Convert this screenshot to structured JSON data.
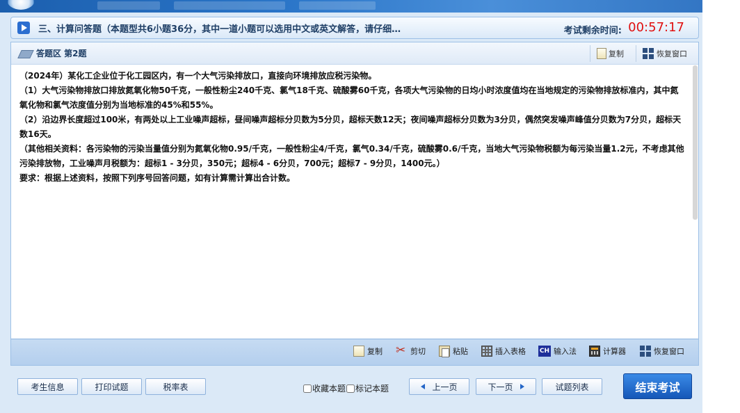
{
  "section": {
    "title": "三、计算问答题（本题型共6小题36分，其中一道小题可以选用中文或英文解答，请仔细…",
    "timer_label": "考试剩余时间:",
    "timer_value": "00:57:17"
  },
  "answer_area": {
    "title": "答题区 第2题",
    "copy_label": "复制",
    "restore_label": "恢复窗口"
  },
  "question": {
    "paragraphs": [
      "（2024年）某化工企业位于化工园区内，有一个大气污染排放口，直接向环境排放应税污染物。",
      "（1）大气污染物排放口排放氮氧化物50千克，一般性粉尘240千克、氯气18千克、硫酸雾60千克，各项大气污染物的日均小时浓度值均在当地规定的污染物排放标准内，其中氮氧化物和氯气浓度值分别为当地标准的45%和55%。",
      "（2）沿边界长度超过100米，有两处以上工业噪声超标，昼间噪声超标分贝数为5分贝，超标天数12天；夜间噪声超标分贝数为3分贝，偶然突发噪声峰值分贝数为7分贝，超标天数16天。",
      "（其他相关资料：各污染物的污染当量值分别为氮氧化物0.95/千克，一般性粉尘4/千克，氯气0.34/千克，硫酸雾0.6/千克，当地大气污染物税额为每污染当量1.2元，不考虑其他污染排放物，工业噪声月税额为：超标1 - 3分贝，350元；超标4 - 6分贝，700元；超标7 - 9分贝，1400元。）",
      "要求：根据上述资料，按照下列序号回答问题，如有计算需计算出合计数。"
    ]
  },
  "toolbar": {
    "copy": "复制",
    "cut": "剪切",
    "paste": "粘贴",
    "insert_table": "插入表格",
    "ime": "输入法",
    "ime_badge": "CH",
    "calculator": "计算器",
    "restore": "恢复窗口"
  },
  "footer": {
    "candidate_info": "考生信息",
    "print_questions": "打印试题",
    "tax_rate_table": "税率表",
    "bookmark": "收藏本题",
    "mark": "标记本题",
    "prev": "上一页",
    "next": "下一页",
    "question_list": "试题列表",
    "end_exam": "结束考试"
  },
  "colors": {
    "timer": "#e01010",
    "accent": "#1557b8",
    "panel_border": "#9dc0e6"
  }
}
